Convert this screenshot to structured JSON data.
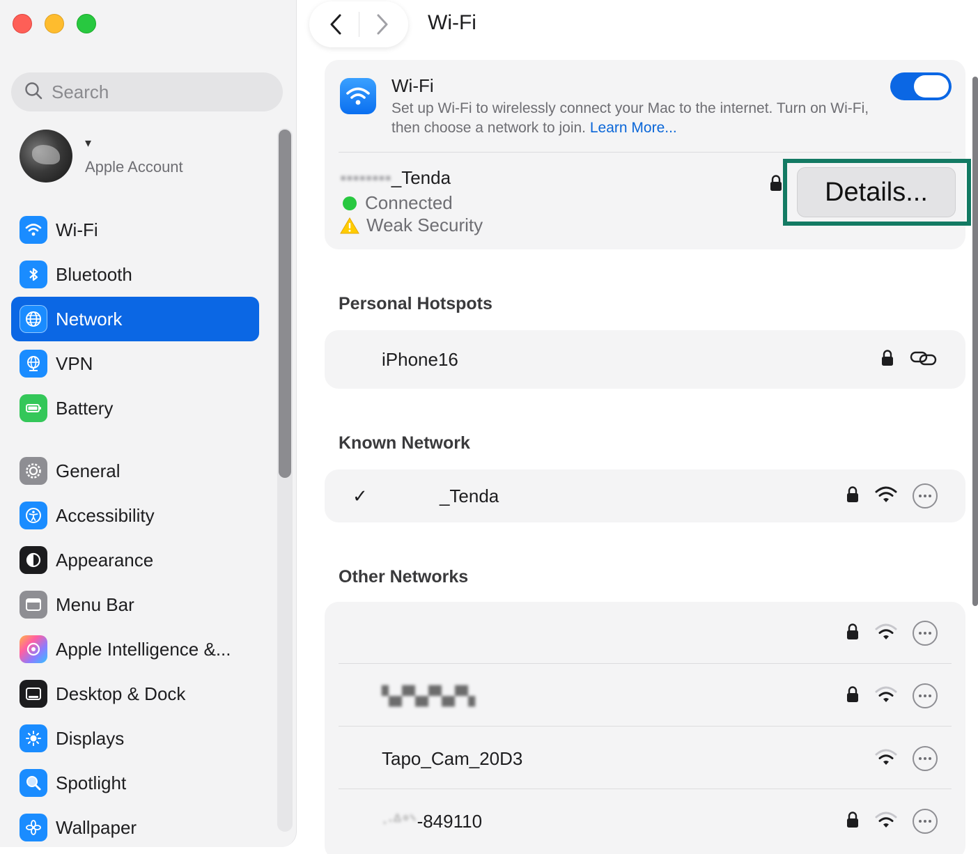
{
  "window": {
    "title": "Wi-Fi"
  },
  "sidebar": {
    "search_placeholder": "Search",
    "account": {
      "name": "▾",
      "subtitle": "Apple Account"
    },
    "items": [
      {
        "label": "Wi-Fi",
        "icon": "wifi-icon",
        "color": "#1a8cff"
      },
      {
        "label": "Bluetooth",
        "icon": "bluetooth-icon",
        "color": "#1a8cff"
      },
      {
        "label": "Network",
        "icon": "globe-icon",
        "color": "#1a8cff",
        "selected": true
      },
      {
        "label": "VPN",
        "icon": "vpn-globe-icon",
        "color": "#1a8cff"
      },
      {
        "label": "Battery",
        "icon": "battery-icon",
        "color": "#34c759"
      },
      {
        "label": "General",
        "icon": "gear-icon",
        "color": "#8e8e93"
      },
      {
        "label": "Accessibility",
        "icon": "accessibility-icon",
        "color": "#1a8cff"
      },
      {
        "label": "Appearance",
        "icon": "appearance-icon",
        "color": "#1c1c1e"
      },
      {
        "label": "Menu Bar",
        "icon": "menu-bar-icon",
        "color": "#8e8e93"
      },
      {
        "label": "Apple Intelligence &...",
        "icon": "apple-intelligence-icon",
        "color": "#ff6b9a"
      },
      {
        "label": "Desktop & Dock",
        "icon": "dock-icon",
        "color": "#1c1c1e"
      },
      {
        "label": "Displays",
        "icon": "sun-icon",
        "color": "#1a8cff"
      },
      {
        "label": "Spotlight",
        "icon": "magnifier-icon",
        "color": "#1a8cff"
      },
      {
        "label": "Wallpaper",
        "icon": "flower-icon",
        "color": "#1a8cff"
      }
    ]
  },
  "wifi_card": {
    "title": "Wi-Fi",
    "description": "Set up Wi-Fi to wirelessly connect your Mac to the internet. Turn on Wi-Fi, then choose a network to join.",
    "learn_more": "Learn More...",
    "enabled": true,
    "current": {
      "name": "_Tenda",
      "status": "Connected",
      "warning": "Weak Security",
      "details_label": "Details..."
    }
  },
  "sections": {
    "hotspots_title": "Personal Hotspots",
    "known_title": "Known Network",
    "other_title": "Other Networks"
  },
  "hotspots": [
    {
      "name": "iPhone16"
    }
  ],
  "known": [
    {
      "name": "_Tenda",
      "checked": "✓"
    }
  ],
  "other_networks": [
    {
      "name": "",
      "locked": true
    },
    {
      "name": "",
      "locked": true
    },
    {
      "name": "Tapo_Cam_20D3",
      "locked": false
    },
    {
      "name": "-849110",
      "locked": true
    }
  ],
  "colors": {
    "accent": "#0b67e4",
    "highlight_frame": "#137a63",
    "status_green": "#28c840",
    "warning_yellow": "#ffcc00"
  }
}
